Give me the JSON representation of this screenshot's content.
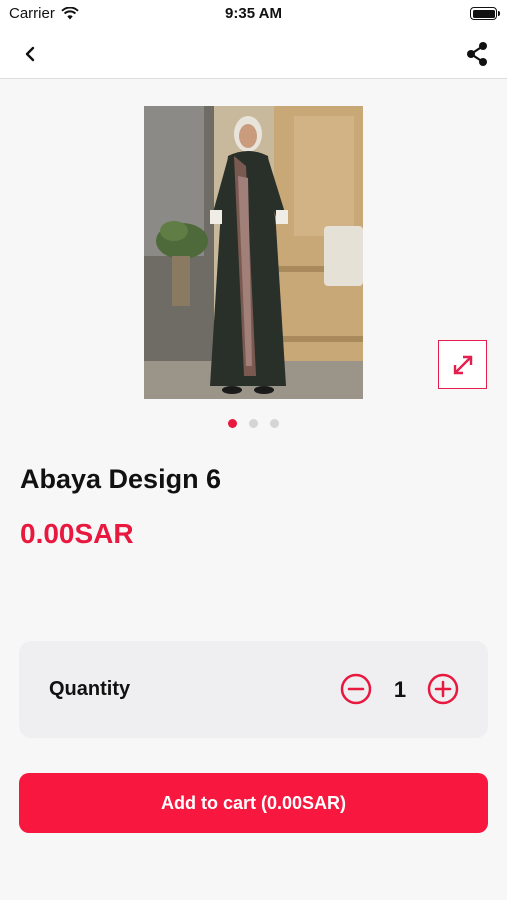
{
  "status_bar": {
    "carrier": "Carrier",
    "time": "9:35 AM",
    "wifi_icon": "wifi-icon",
    "battery_icon": "battery-icon"
  },
  "nav": {
    "back_icon": "chevron-left-icon",
    "share_icon": "share-icon"
  },
  "product": {
    "image_alt": "Abaya Design 6",
    "title": "Abaya Design 6",
    "price": "0.00SAR",
    "expand_icon": "expand-icon"
  },
  "carousel": {
    "count": 3,
    "active_index": 0
  },
  "quantity": {
    "label": "Quantity",
    "value": "1",
    "minus_icon": "minus-circle-icon",
    "plus_icon": "plus-circle-icon"
  },
  "cart": {
    "button_label": "Add to cart (0.00SAR)"
  },
  "colors": {
    "accent": "#e8183f",
    "background": "#f7f7f7",
    "card": "#efeff1"
  }
}
